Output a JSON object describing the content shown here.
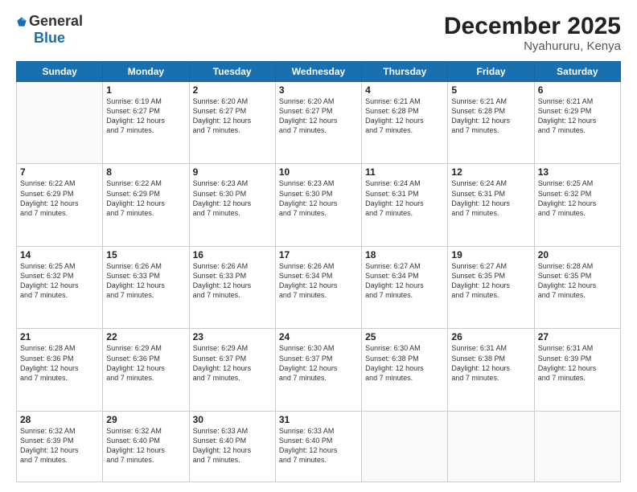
{
  "header": {
    "logo_general": "General",
    "logo_blue": "Blue",
    "title": "December 2025",
    "subtitle": "Nyahururu, Kenya"
  },
  "weekdays": [
    "Sunday",
    "Monday",
    "Tuesday",
    "Wednesday",
    "Thursday",
    "Friday",
    "Saturday"
  ],
  "weeks": [
    [
      {
        "day": "",
        "info": ""
      },
      {
        "day": "1",
        "info": "Sunrise: 6:19 AM\nSunset: 6:27 PM\nDaylight: 12 hours\nand 7 minutes."
      },
      {
        "day": "2",
        "info": "Sunrise: 6:20 AM\nSunset: 6:27 PM\nDaylight: 12 hours\nand 7 minutes."
      },
      {
        "day": "3",
        "info": "Sunrise: 6:20 AM\nSunset: 6:27 PM\nDaylight: 12 hours\nand 7 minutes."
      },
      {
        "day": "4",
        "info": "Sunrise: 6:21 AM\nSunset: 6:28 PM\nDaylight: 12 hours\nand 7 minutes."
      },
      {
        "day": "5",
        "info": "Sunrise: 6:21 AM\nSunset: 6:28 PM\nDaylight: 12 hours\nand 7 minutes."
      },
      {
        "day": "6",
        "info": "Sunrise: 6:21 AM\nSunset: 6:29 PM\nDaylight: 12 hours\nand 7 minutes."
      }
    ],
    [
      {
        "day": "7",
        "info": "Sunrise: 6:22 AM\nSunset: 6:29 PM\nDaylight: 12 hours\nand 7 minutes."
      },
      {
        "day": "8",
        "info": "Sunrise: 6:22 AM\nSunset: 6:29 PM\nDaylight: 12 hours\nand 7 minutes."
      },
      {
        "day": "9",
        "info": "Sunrise: 6:23 AM\nSunset: 6:30 PM\nDaylight: 12 hours\nand 7 minutes."
      },
      {
        "day": "10",
        "info": "Sunrise: 6:23 AM\nSunset: 6:30 PM\nDaylight: 12 hours\nand 7 minutes."
      },
      {
        "day": "11",
        "info": "Sunrise: 6:24 AM\nSunset: 6:31 PM\nDaylight: 12 hours\nand 7 minutes."
      },
      {
        "day": "12",
        "info": "Sunrise: 6:24 AM\nSunset: 6:31 PM\nDaylight: 12 hours\nand 7 minutes."
      },
      {
        "day": "13",
        "info": "Sunrise: 6:25 AM\nSunset: 6:32 PM\nDaylight: 12 hours\nand 7 minutes."
      }
    ],
    [
      {
        "day": "14",
        "info": "Sunrise: 6:25 AM\nSunset: 6:32 PM\nDaylight: 12 hours\nand 7 minutes."
      },
      {
        "day": "15",
        "info": "Sunrise: 6:26 AM\nSunset: 6:33 PM\nDaylight: 12 hours\nand 7 minutes."
      },
      {
        "day": "16",
        "info": "Sunrise: 6:26 AM\nSunset: 6:33 PM\nDaylight: 12 hours\nand 7 minutes."
      },
      {
        "day": "17",
        "info": "Sunrise: 6:26 AM\nSunset: 6:34 PM\nDaylight: 12 hours\nand 7 minutes."
      },
      {
        "day": "18",
        "info": "Sunrise: 6:27 AM\nSunset: 6:34 PM\nDaylight: 12 hours\nand 7 minutes."
      },
      {
        "day": "19",
        "info": "Sunrise: 6:27 AM\nSunset: 6:35 PM\nDaylight: 12 hours\nand 7 minutes."
      },
      {
        "day": "20",
        "info": "Sunrise: 6:28 AM\nSunset: 6:35 PM\nDaylight: 12 hours\nand 7 minutes."
      }
    ],
    [
      {
        "day": "21",
        "info": "Sunrise: 6:28 AM\nSunset: 6:36 PM\nDaylight: 12 hours\nand 7 minutes."
      },
      {
        "day": "22",
        "info": "Sunrise: 6:29 AM\nSunset: 6:36 PM\nDaylight: 12 hours\nand 7 minutes."
      },
      {
        "day": "23",
        "info": "Sunrise: 6:29 AM\nSunset: 6:37 PM\nDaylight: 12 hours\nand 7 minutes."
      },
      {
        "day": "24",
        "info": "Sunrise: 6:30 AM\nSunset: 6:37 PM\nDaylight: 12 hours\nand 7 minutes."
      },
      {
        "day": "25",
        "info": "Sunrise: 6:30 AM\nSunset: 6:38 PM\nDaylight: 12 hours\nand 7 minutes."
      },
      {
        "day": "26",
        "info": "Sunrise: 6:31 AM\nSunset: 6:38 PM\nDaylight: 12 hours\nand 7 minutes."
      },
      {
        "day": "27",
        "info": "Sunrise: 6:31 AM\nSunset: 6:39 PM\nDaylight: 12 hours\nand 7 minutes."
      }
    ],
    [
      {
        "day": "28",
        "info": "Sunrise: 6:32 AM\nSunset: 6:39 PM\nDaylight: 12 hours\nand 7 minutes."
      },
      {
        "day": "29",
        "info": "Sunrise: 6:32 AM\nSunset: 6:40 PM\nDaylight: 12 hours\nand 7 minutes."
      },
      {
        "day": "30",
        "info": "Sunrise: 6:33 AM\nSunset: 6:40 PM\nDaylight: 12 hours\nand 7 minutes."
      },
      {
        "day": "31",
        "info": "Sunrise: 6:33 AM\nSunset: 6:40 PM\nDaylight: 12 hours\nand 7 minutes."
      },
      {
        "day": "",
        "info": ""
      },
      {
        "day": "",
        "info": ""
      },
      {
        "day": "",
        "info": ""
      }
    ]
  ]
}
